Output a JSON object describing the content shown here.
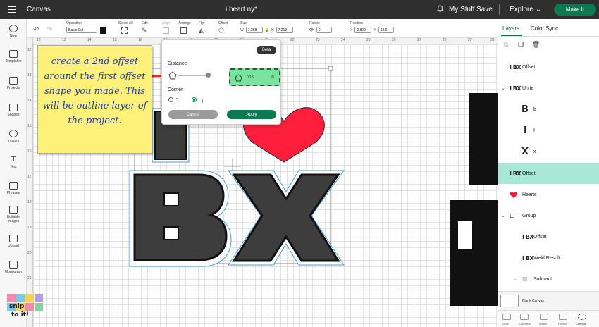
{
  "app": {
    "title": "Canvas",
    "document_title": "i heart ny*"
  },
  "header": {
    "my_stuff": "My Stuff",
    "save": "Save",
    "explore": "Explore",
    "make_it": "Make It"
  },
  "rail": [
    "New",
    "Templates",
    "Projects",
    "Shapes",
    "Images",
    "Text",
    "Phrases",
    "Editable Images",
    "Upload",
    "Monogram"
  ],
  "toolbar": {
    "operation_label": "Operation",
    "operation_value": "Basic Cut",
    "select_all": "Select All",
    "edit": "Edit",
    "align": "Align",
    "arrange": "Arrange",
    "flip": "Flip",
    "offset": "Offset",
    "size": "Size",
    "w_label": "W",
    "w_value": "7.258",
    "h_label": "H",
    "h_value": "7.213",
    "rotate": "Rotate",
    "rotate_value": "0",
    "position": "Position",
    "x_label": "X",
    "x_value": "2.809",
    "y_label": "Y",
    "y_value": "12.6"
  },
  "ruler": {
    "top": [
      "12",
      "13",
      "14",
      "15",
      "16",
      "17",
      "18",
      "19",
      "20",
      "21",
      "22",
      "23",
      "24",
      "25",
      "26",
      "27",
      "28",
      "29",
      "30"
    ],
    "left": [
      "12",
      "13",
      "14",
      "15",
      "16",
      "17",
      "18",
      "19",
      "20",
      "21"
    ]
  },
  "note": {
    "text": "create a 2nd offset around the first offset shape you made. This will be outline layer of the project."
  },
  "offset_popup": {
    "beta": "Beta",
    "distance_label": "Distance",
    "distance_value": "0.15",
    "unit": "in",
    "corner_label": "Corner",
    "cancel": "Cancel",
    "apply": "Apply"
  },
  "panel": {
    "tab_layers": "Layers",
    "tab_color_sync": "Color Sync",
    "layers": [
      {
        "label": "Offset",
        "icon": "IBX"
      },
      {
        "label": "Unite",
        "icon": "IBX"
      },
      {
        "label": "b",
        "icon": "B"
      },
      {
        "label": "I",
        "icon": "I"
      },
      {
        "label": "x",
        "icon": "X"
      },
      {
        "label": "Offset",
        "icon": "IBX"
      },
      {
        "label": "Hearts",
        "icon": "heart"
      },
      {
        "label": "Group",
        "icon": "group"
      },
      {
        "label": "Offset",
        "icon": "IBX"
      },
      {
        "label": "Weld Result",
        "icon": "IBX"
      },
      {
        "label": "Subtract",
        "icon": "subtract"
      }
    ],
    "blank_canvas": "Blank Canvas",
    "bottom_tools": [
      "Slice",
      "Combine",
      "Attach",
      "Flatten",
      "Contour"
    ]
  },
  "colors": {
    "accent": "#0b7a50",
    "selected_row": "#a8e8d5",
    "heart": "#ff1f3d",
    "distance_highlight": "#7be39f",
    "note": "#fdf17a",
    "arrow": "#e8351f"
  },
  "logo_text": [
    "snip",
    "to it!"
  ]
}
